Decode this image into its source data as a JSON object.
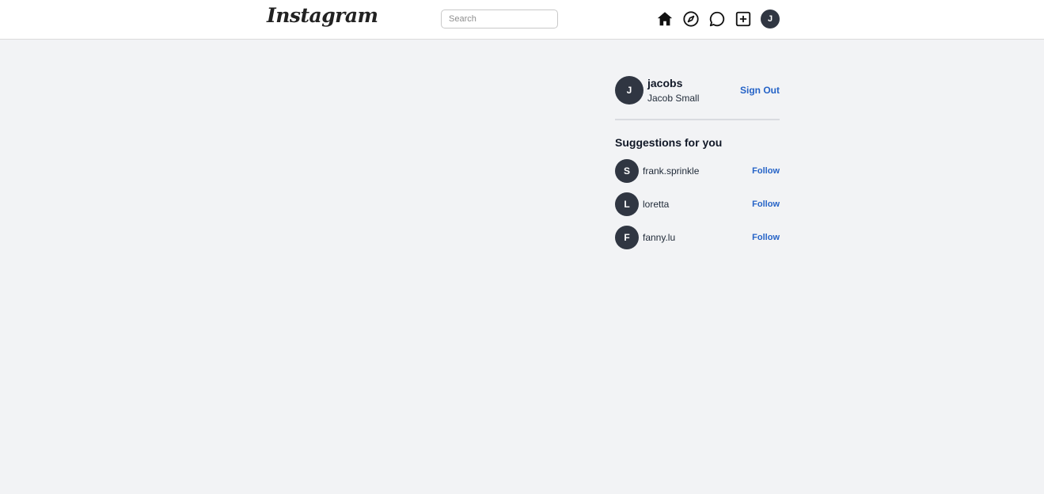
{
  "header": {
    "logo_text": "Instagram",
    "search_placeholder": "Search",
    "search_value": "",
    "nav": [
      "home-icon",
      "explore-compass-icon",
      "messages-chat-icon",
      "new-post-plus-icon"
    ],
    "avatar_initial": "J"
  },
  "profile": {
    "initial": "J",
    "username": "jacobs",
    "full_name": "Jacob Small",
    "signout_label": "Sign Out"
  },
  "suggestions": {
    "title": "Suggestions for you",
    "follow_label": "Follow",
    "items": [
      {
        "initial": "S",
        "username": "frank.sprinkle"
      },
      {
        "initial": "L",
        "username": "loretta"
      },
      {
        "initial": "F",
        "username": "fanny.lu"
      }
    ]
  },
  "colors": {
    "background": "#f2f3f5",
    "avatar": "#303642",
    "link": "#2563c7"
  }
}
